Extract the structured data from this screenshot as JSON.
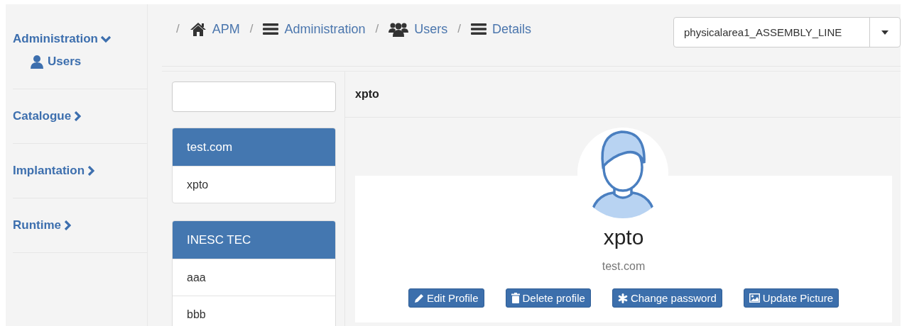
{
  "sidebar": {
    "items": [
      {
        "label": "Administration",
        "expanded": true,
        "children": [
          {
            "label": "Users",
            "kind": "user"
          }
        ]
      },
      {
        "label": "Catalogue",
        "expanded": false
      },
      {
        "label": "Implantation",
        "expanded": false
      },
      {
        "label": "Runtime",
        "expanded": false
      }
    ]
  },
  "breadcrumb": [
    {
      "separator": "/",
      "label": "APM",
      "kind": "home"
    },
    {
      "separator": "/",
      "label": "Administration",
      "kind": "list"
    },
    {
      "separator": "/",
      "label": "Users",
      "kind": "group"
    },
    {
      "separator": "/",
      "label": "Details",
      "kind": "list"
    }
  ],
  "area_select": {
    "value": "physicalarea1_ASSEMBLY_LINE"
  },
  "user_list": {
    "groups": [
      {
        "name": "test.com",
        "users": [
          "xpto"
        ]
      },
      {
        "name": "INESC TEC",
        "users": [
          "aaa",
          "bbb"
        ]
      }
    ]
  },
  "detail": {
    "header": "xpto",
    "name": "xpto",
    "organization": "test.com",
    "actions": [
      {
        "label": "Edit Profile",
        "kind": "edit"
      },
      {
        "label": "Delete profile",
        "kind": "delete"
      },
      {
        "label": "Change password",
        "kind": "password"
      },
      {
        "label": "Update Picture",
        "kind": "picture"
      }
    ]
  }
}
